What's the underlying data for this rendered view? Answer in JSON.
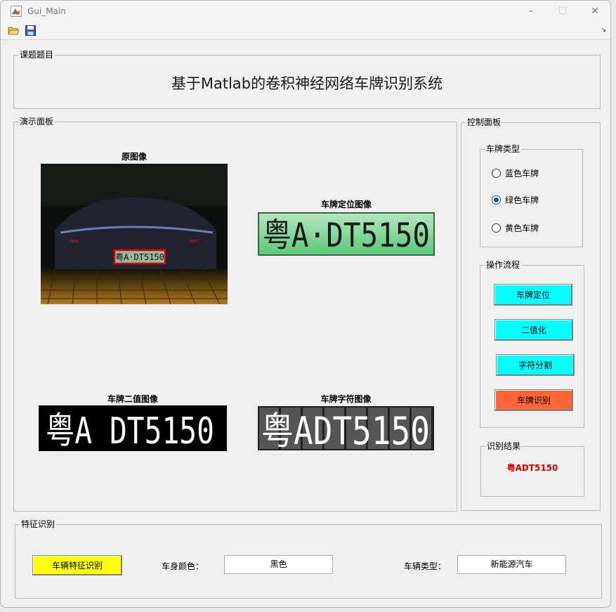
{
  "window": {
    "title": "Gui_Main"
  },
  "toolbar": {
    "open_icon": "folder-open-icon",
    "save_icon": "save-disk-icon"
  },
  "topic_group": {
    "title": "课题题目",
    "heading": "基于Matlab的卷积神经网络车牌识别系统"
  },
  "demo_panel": {
    "title": "演示面板",
    "original_label": "原图像",
    "located_label": "车牌定位图像",
    "binary_label": "车牌二值图像",
    "chars_label": "车牌字符图像",
    "plate_text_original": "粤A·DT5150",
    "plate_text_located": "粤A·DT5150",
    "plate_text_binary": "粤A DT5150",
    "plate_text_chars": "粤ADT5150"
  },
  "control_panel": {
    "title": "控制面板",
    "plate_type": {
      "title": "车牌类型",
      "options": [
        "蓝色车牌",
        "绿色车牌",
        "黄色车牌"
      ],
      "selected": "绿色车牌"
    },
    "process": {
      "title": "操作流程",
      "buttons": [
        "车牌定位",
        "二值化",
        "字符分割",
        "车牌识别"
      ]
    },
    "result": {
      "title": "识别结果",
      "value": "粤ADT5150",
      "color": "#e00000"
    }
  },
  "feature_group": {
    "title": "特征识别",
    "button": "车辆特征识别",
    "body_color_label": "车身颜色：",
    "body_color_value": "黑色",
    "vehicle_type_label": "车辆类型：",
    "vehicle_type_value": "新能源汽车"
  },
  "colors": {
    "cyan_button": "#00ffff",
    "orange_button": "#ff6633",
    "yellow_button": "#ffff00",
    "radio_selected": "#0a5fb4"
  }
}
